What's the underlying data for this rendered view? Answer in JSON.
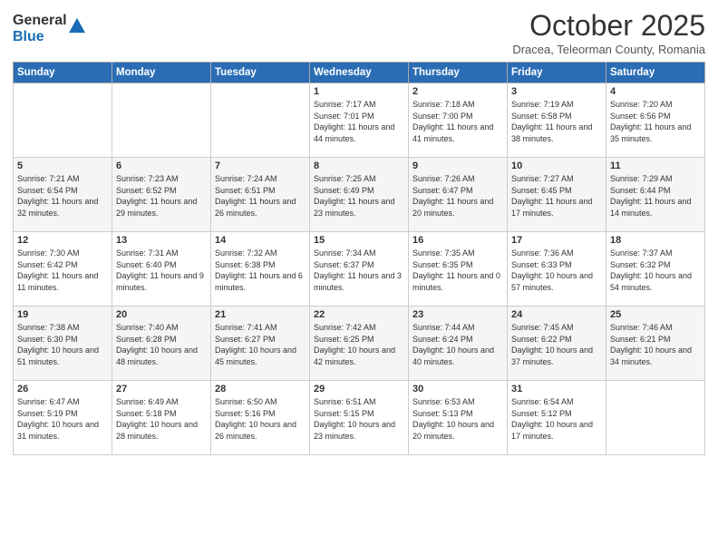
{
  "logo": {
    "general": "General",
    "blue": "Blue"
  },
  "header": {
    "month": "October 2025",
    "location": "Dracea, Teleorman County, Romania"
  },
  "days_of_week": [
    "Sunday",
    "Monday",
    "Tuesday",
    "Wednesday",
    "Thursday",
    "Friday",
    "Saturday"
  ],
  "weeks": [
    [
      {
        "day": "",
        "info": ""
      },
      {
        "day": "",
        "info": ""
      },
      {
        "day": "",
        "info": ""
      },
      {
        "day": "1",
        "info": "Sunrise: 7:17 AM\nSunset: 7:01 PM\nDaylight: 11 hours and 44 minutes."
      },
      {
        "day": "2",
        "info": "Sunrise: 7:18 AM\nSunset: 7:00 PM\nDaylight: 11 hours and 41 minutes."
      },
      {
        "day": "3",
        "info": "Sunrise: 7:19 AM\nSunset: 6:58 PM\nDaylight: 11 hours and 38 minutes."
      },
      {
        "day": "4",
        "info": "Sunrise: 7:20 AM\nSunset: 6:56 PM\nDaylight: 11 hours and 35 minutes."
      }
    ],
    [
      {
        "day": "5",
        "info": "Sunrise: 7:21 AM\nSunset: 6:54 PM\nDaylight: 11 hours and 32 minutes."
      },
      {
        "day": "6",
        "info": "Sunrise: 7:23 AM\nSunset: 6:52 PM\nDaylight: 11 hours and 29 minutes."
      },
      {
        "day": "7",
        "info": "Sunrise: 7:24 AM\nSunset: 6:51 PM\nDaylight: 11 hours and 26 minutes."
      },
      {
        "day": "8",
        "info": "Sunrise: 7:25 AM\nSunset: 6:49 PM\nDaylight: 11 hours and 23 minutes."
      },
      {
        "day": "9",
        "info": "Sunrise: 7:26 AM\nSunset: 6:47 PM\nDaylight: 11 hours and 20 minutes."
      },
      {
        "day": "10",
        "info": "Sunrise: 7:27 AM\nSunset: 6:45 PM\nDaylight: 11 hours and 17 minutes."
      },
      {
        "day": "11",
        "info": "Sunrise: 7:29 AM\nSunset: 6:44 PM\nDaylight: 11 hours and 14 minutes."
      }
    ],
    [
      {
        "day": "12",
        "info": "Sunrise: 7:30 AM\nSunset: 6:42 PM\nDaylight: 11 hours and 11 minutes."
      },
      {
        "day": "13",
        "info": "Sunrise: 7:31 AM\nSunset: 6:40 PM\nDaylight: 11 hours and 9 minutes."
      },
      {
        "day": "14",
        "info": "Sunrise: 7:32 AM\nSunset: 6:38 PM\nDaylight: 11 hours and 6 minutes."
      },
      {
        "day": "15",
        "info": "Sunrise: 7:34 AM\nSunset: 6:37 PM\nDaylight: 11 hours and 3 minutes."
      },
      {
        "day": "16",
        "info": "Sunrise: 7:35 AM\nSunset: 6:35 PM\nDaylight: 11 hours and 0 minutes."
      },
      {
        "day": "17",
        "info": "Sunrise: 7:36 AM\nSunset: 6:33 PM\nDaylight: 10 hours and 57 minutes."
      },
      {
        "day": "18",
        "info": "Sunrise: 7:37 AM\nSunset: 6:32 PM\nDaylight: 10 hours and 54 minutes."
      }
    ],
    [
      {
        "day": "19",
        "info": "Sunrise: 7:38 AM\nSunset: 6:30 PM\nDaylight: 10 hours and 51 minutes."
      },
      {
        "day": "20",
        "info": "Sunrise: 7:40 AM\nSunset: 6:28 PM\nDaylight: 10 hours and 48 minutes."
      },
      {
        "day": "21",
        "info": "Sunrise: 7:41 AM\nSunset: 6:27 PM\nDaylight: 10 hours and 45 minutes."
      },
      {
        "day": "22",
        "info": "Sunrise: 7:42 AM\nSunset: 6:25 PM\nDaylight: 10 hours and 42 minutes."
      },
      {
        "day": "23",
        "info": "Sunrise: 7:44 AM\nSunset: 6:24 PM\nDaylight: 10 hours and 40 minutes."
      },
      {
        "day": "24",
        "info": "Sunrise: 7:45 AM\nSunset: 6:22 PM\nDaylight: 10 hours and 37 minutes."
      },
      {
        "day": "25",
        "info": "Sunrise: 7:46 AM\nSunset: 6:21 PM\nDaylight: 10 hours and 34 minutes."
      }
    ],
    [
      {
        "day": "26",
        "info": "Sunrise: 6:47 AM\nSunset: 5:19 PM\nDaylight: 10 hours and 31 minutes."
      },
      {
        "day": "27",
        "info": "Sunrise: 6:49 AM\nSunset: 5:18 PM\nDaylight: 10 hours and 28 minutes."
      },
      {
        "day": "28",
        "info": "Sunrise: 6:50 AM\nSunset: 5:16 PM\nDaylight: 10 hours and 26 minutes."
      },
      {
        "day": "29",
        "info": "Sunrise: 6:51 AM\nSunset: 5:15 PM\nDaylight: 10 hours and 23 minutes."
      },
      {
        "day": "30",
        "info": "Sunrise: 6:53 AM\nSunset: 5:13 PM\nDaylight: 10 hours and 20 minutes."
      },
      {
        "day": "31",
        "info": "Sunrise: 6:54 AM\nSunset: 5:12 PM\nDaylight: 10 hours and 17 minutes."
      },
      {
        "day": "",
        "info": ""
      }
    ]
  ]
}
